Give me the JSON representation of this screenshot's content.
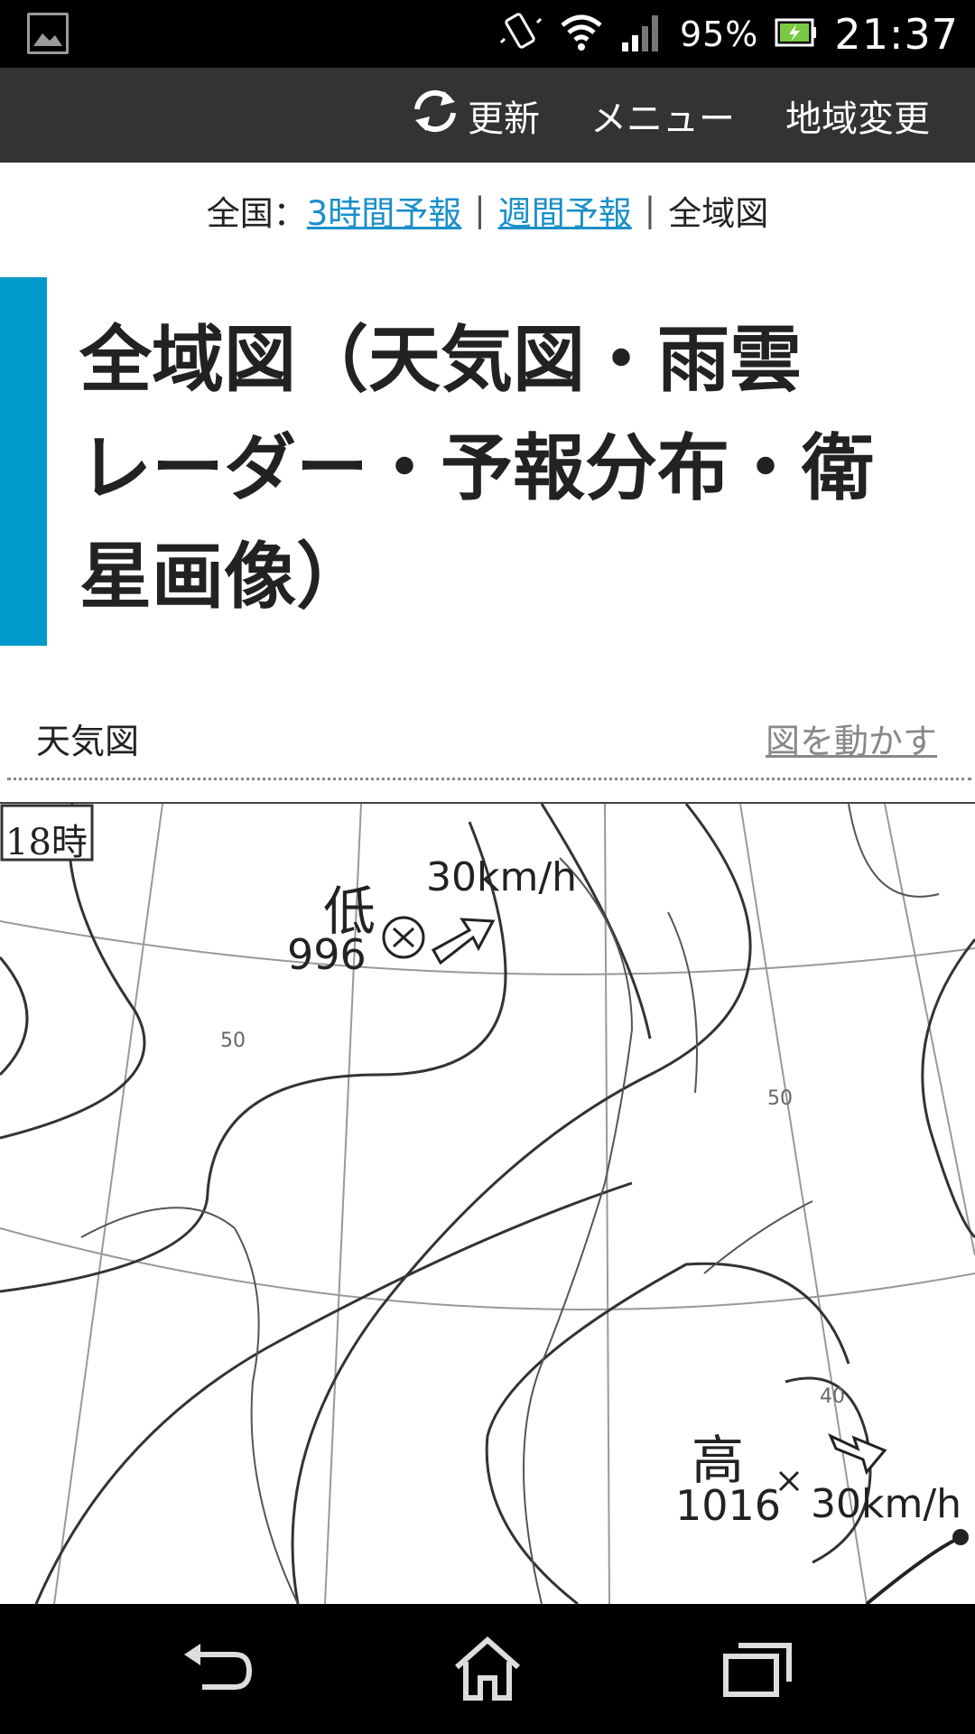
{
  "status": {
    "battery_pct": "95%",
    "time": "21:37"
  },
  "action_bar": {
    "refresh": "更新",
    "menu": "メニュー",
    "region": "地域変更"
  },
  "breadcrumb": {
    "prefix": "全国：",
    "link1": "3時間予報",
    "link2": "週間予報",
    "current": "全域図"
  },
  "title_lines": [
    "全域図（天気図・雨雲",
    "レーダー・予報分布・衛",
    "星画像）"
  ],
  "section": {
    "label": "天気図",
    "move_link": "図を動かす"
  },
  "map": {
    "time_label": "18時",
    "low_kanji": "低",
    "low_pressure": "996",
    "low_speed": "30km/h",
    "high_kanji": "高",
    "high_pressure": "1016",
    "high_speed": "30km/h",
    "lat1": "50",
    "lat2": "50",
    "lat3": "40"
  }
}
